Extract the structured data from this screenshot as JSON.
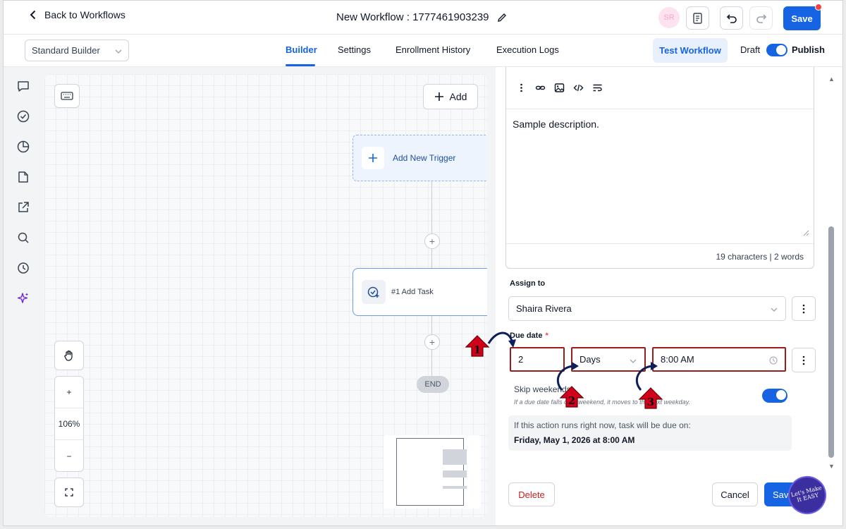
{
  "header": {
    "back_label": "Back to Workflows",
    "workflow_title": "New Workflow : 1777461903239",
    "avatar_initials": "SR",
    "save_label": "Save"
  },
  "subbar": {
    "builder_mode": "Standard Builder",
    "tabs": [
      {
        "label": "Builder",
        "active": true
      },
      {
        "label": "Settings",
        "active": false
      },
      {
        "label": "Enrollment History",
        "active": false
      },
      {
        "label": "Execution Logs",
        "active": false
      }
    ],
    "test_workflow_label": "Test Workflow",
    "draft_label": "Draft",
    "publish_label": "Publish",
    "publish_enabled": true
  },
  "canvas": {
    "add_label": "Add",
    "trigger_label": "Add New Trigger",
    "task_label": "#1 Add Task",
    "end_label": "END",
    "zoom_level": "106%",
    "zoom_in": "+",
    "zoom_out": "−"
  },
  "panel": {
    "description_text": "Sample description.",
    "char_count": "19 characters | 2 words",
    "assign_to_label": "Assign to",
    "assign_to_value": "Shaira Rivera",
    "due_date_label": "Due date",
    "due_date_required": "*",
    "due_amount": "2",
    "due_unit": "Days",
    "due_time": "8:00 AM",
    "skip_weekends_label": "Skip weekends",
    "skip_weekends_hint": "If a due date falls on a weekend, it moves to the next weekday.",
    "skip_weekends_on": true,
    "preview_line1": "If this action runs right now, task will be due on:",
    "preview_line2": "Friday, May 1, 2026 at 8:00 AM",
    "delete_label": "Delete",
    "cancel_label": "Cancel",
    "save_label": "Save"
  },
  "annotations": {
    "step1": "1",
    "step2": "2",
    "step3": "3",
    "watermark": "Let's Make It EASY"
  },
  "colors": {
    "accent": "#1663e3",
    "danger": "#c81e1e",
    "annotation": "#d0021b"
  }
}
